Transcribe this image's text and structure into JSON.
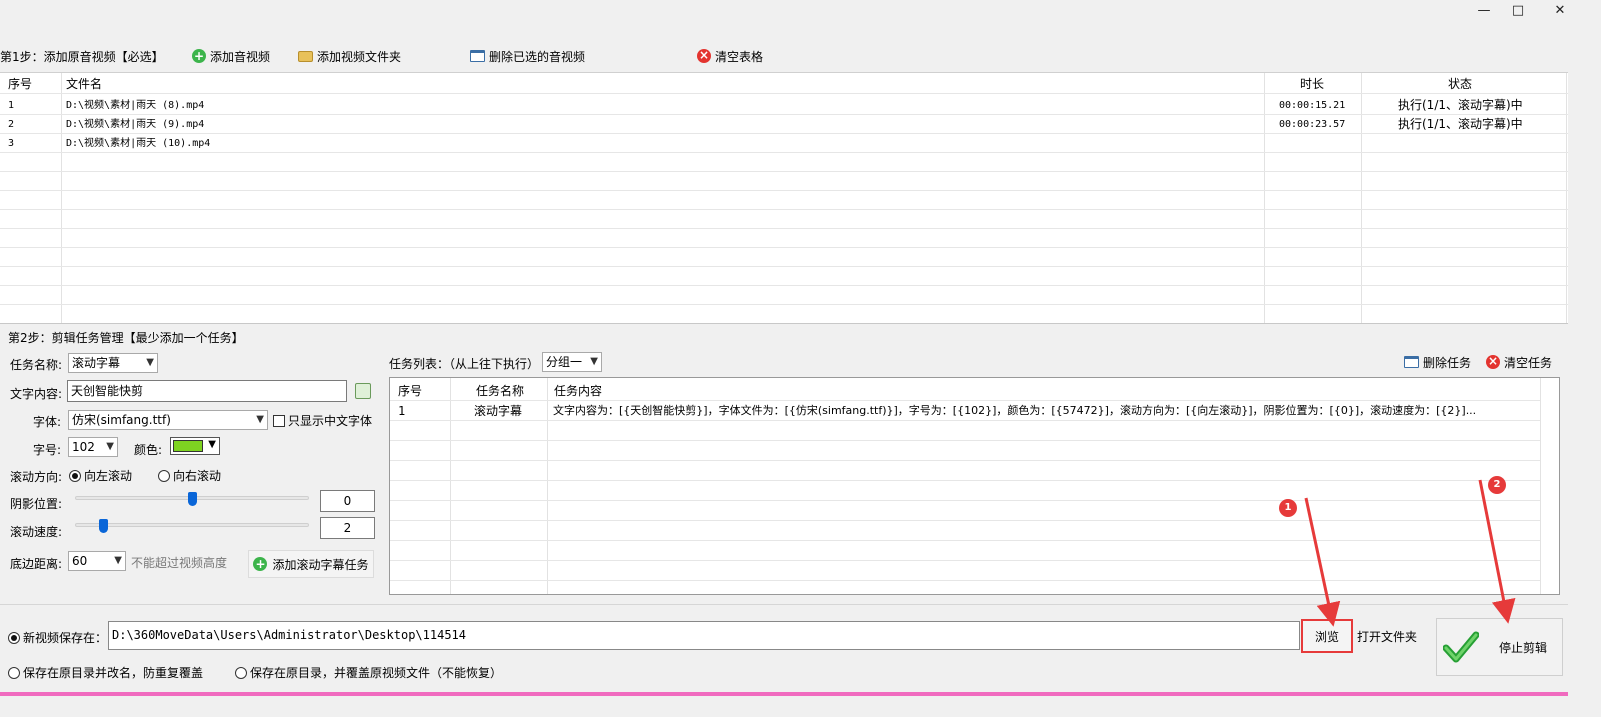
{
  "window": {
    "minimize": "—",
    "maximize": "□",
    "close": "✕"
  },
  "step1": {
    "label": "第1步：添加原音视频【必选】",
    "add_media": "添加音视频",
    "add_folder": "添加视频文件夹",
    "delete_selected": "删除已选的音视频",
    "clear_table": "清空表格"
  },
  "file_table": {
    "headers": {
      "index": "序号",
      "filename": "文件名",
      "duration": "时长",
      "status": "状态"
    },
    "rows": [
      {
        "index": "1",
        "filename": "D:\\视频\\素材|雨天 (8).mp4",
        "duration": "00:00:15.21",
        "status": "执行(1/1、滚动字幕)中"
      },
      {
        "index": "2",
        "filename": "D:\\视频\\素材|雨天 (9).mp4",
        "duration": "00:00:23.57",
        "status": "执行(1/1、滚动字幕)中"
      },
      {
        "index": "3",
        "filename": "D:\\视频\\素材|雨天 (10).mp4",
        "duration": "",
        "status": ""
      }
    ]
  },
  "step2": {
    "label": "第2步：剪辑任务管理【最少添加一个任务】",
    "task_name_label": "任务名称:",
    "task_name_value": "滚动字幕",
    "text_content_label": "文字内容:",
    "text_content_value": "天创智能快剪",
    "font_label": "字体:",
    "font_value": "仿宋(simfang.ttf)",
    "chinese_only_label": "只显示中文字体",
    "size_label": "字号:",
    "size_value": "102",
    "color_label": "颜色:",
    "color_value": "#7ed321",
    "direction_label": "滚动方向:",
    "direction_left": "向左滚动",
    "direction_right": "向右滚动",
    "shadow_label": "阴影位置:",
    "shadow_value": "0",
    "shadow_fraction": 0.5,
    "speed_label": "滚动速度:",
    "speed_value": "2",
    "speed_fraction": 0.12,
    "margin_label": "底边距离:",
    "margin_value": "60",
    "margin_hint": "不能超过视频高度",
    "add_task_button": "添加滚动字幕任务"
  },
  "task_list": {
    "label": "任务列表：（从上往下执行）",
    "group_value": "分组一",
    "delete_task": "删除任务",
    "clear_tasks": "清空任务",
    "headers": {
      "index": "序号",
      "name": "任务名称",
      "content": "任务内容"
    },
    "rows": [
      {
        "index": "1",
        "name": "滚动字幕",
        "content": "文字内容为：[{天创智能快剪}]，字体文件为：[{仿宋(simfang.ttf)}]，字号为：[{102}]，颜色为：[{57472}]，滚动方向为：[{向左滚动}]，阴影位置为：[{0}]，滚动速度为：[{2}]..."
      }
    ]
  },
  "output": {
    "new_save_label": "新视频保存在：",
    "save_path": "D:\\360MoveData\\Users\\Administrator\\Desktop\\114514",
    "browse": "浏览",
    "open_folder": "打开文件夹",
    "rename_option": "保存在原目录并改名，防重复覆盖",
    "overwrite_option": "保存在原目录，并覆盖原视频文件（不能恢复）",
    "stop_button": "停止剪辑"
  },
  "annotations": {
    "marker1": "1",
    "marker2": "2"
  },
  "colors": {
    "accent_bar": "#f06bbf",
    "annotation_red": "#e63a3a"
  }
}
